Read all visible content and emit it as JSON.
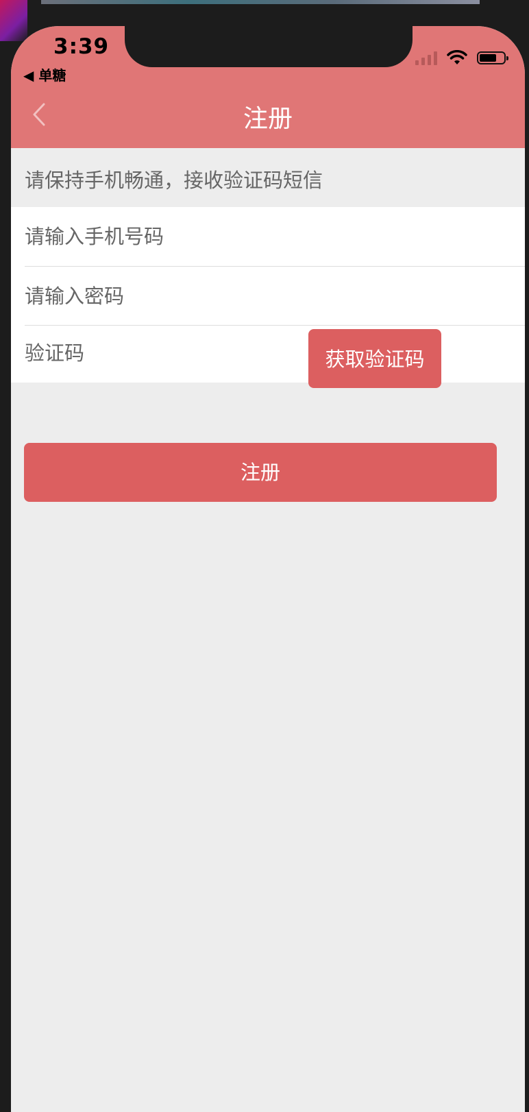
{
  "status_bar": {
    "time": "3:39",
    "back_app": "◀ 单糖"
  },
  "nav": {
    "title": "注册",
    "back_icon": "chevron-left-icon"
  },
  "hint": {
    "text": "请保持手机畅通，接收验证码短信"
  },
  "form": {
    "phone_placeholder": "请输入手机号码",
    "password_placeholder": "请输入密码",
    "code_placeholder": "验证码",
    "get_code_label": "获取验证码"
  },
  "actions": {
    "register_label": "注册"
  },
  "colors": {
    "header_bg": "#e07676",
    "accent": "#dc5f60",
    "page_bg": "#ededed"
  }
}
